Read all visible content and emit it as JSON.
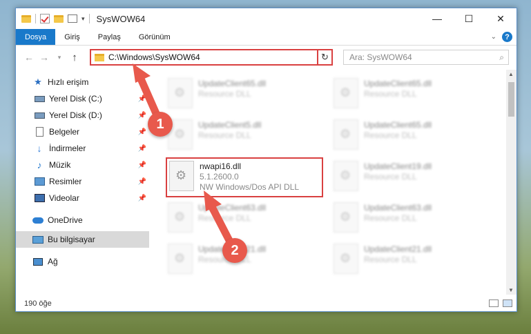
{
  "titlebar": {
    "title": "SysWOW64",
    "minimize": "—",
    "maximize": "☐",
    "close": "✕"
  },
  "ribbon": {
    "tabs": [
      "Dosya",
      "Giriş",
      "Paylaş",
      "Görünüm"
    ],
    "help": "?"
  },
  "navbar": {
    "address": "C:\\Windows\\SysWOW64",
    "search_placeholder": "Ara: SysWOW64"
  },
  "sidebar": {
    "quick_access": "Hızlı erişim",
    "items": [
      {
        "label": "Yerel Disk (C:)"
      },
      {
        "label": "Yerel Disk (D:)"
      },
      {
        "label": "Belgeler"
      },
      {
        "label": "İndirmeler"
      },
      {
        "label": "Müzik"
      },
      {
        "label": "Resimler"
      },
      {
        "label": "Videolar"
      }
    ],
    "onedrive": "OneDrive",
    "this_pc": "Bu bilgisayar",
    "network": "Ağ"
  },
  "files": {
    "left": [
      {
        "name": "UpdateClient65.dll",
        "sub": "Resource DLL"
      },
      {
        "name": "UpdateClient5.dll",
        "sub": "Resource DLL"
      },
      {
        "name": "nwapi16.dll",
        "version": "5.1.2600.0",
        "desc": "NW Windows/Dos API DLL"
      },
      {
        "name": "UpdateClient63.dll",
        "sub": "Resource DLL"
      },
      {
        "name": "UpdateClient21.dll",
        "sub": "Resource DLL"
      }
    ],
    "right": [
      {
        "name": "UpdateClient65.dll",
        "sub": "Resource DLL"
      },
      {
        "name": "UpdateClient65.dll",
        "sub": "Resource DLL"
      },
      {
        "name": "UpdateClient19.dll",
        "sub": "Resource DLL"
      },
      {
        "name": "UpdateClient63.dll",
        "sub": "Resource DLL"
      },
      {
        "name": "UpdateClient21.dll",
        "sub": "Resource DLL"
      }
    ]
  },
  "status": {
    "count": "190 öğe"
  },
  "annotations": {
    "badge1": "1",
    "badge2": "2",
    "color": "#e8594c"
  }
}
